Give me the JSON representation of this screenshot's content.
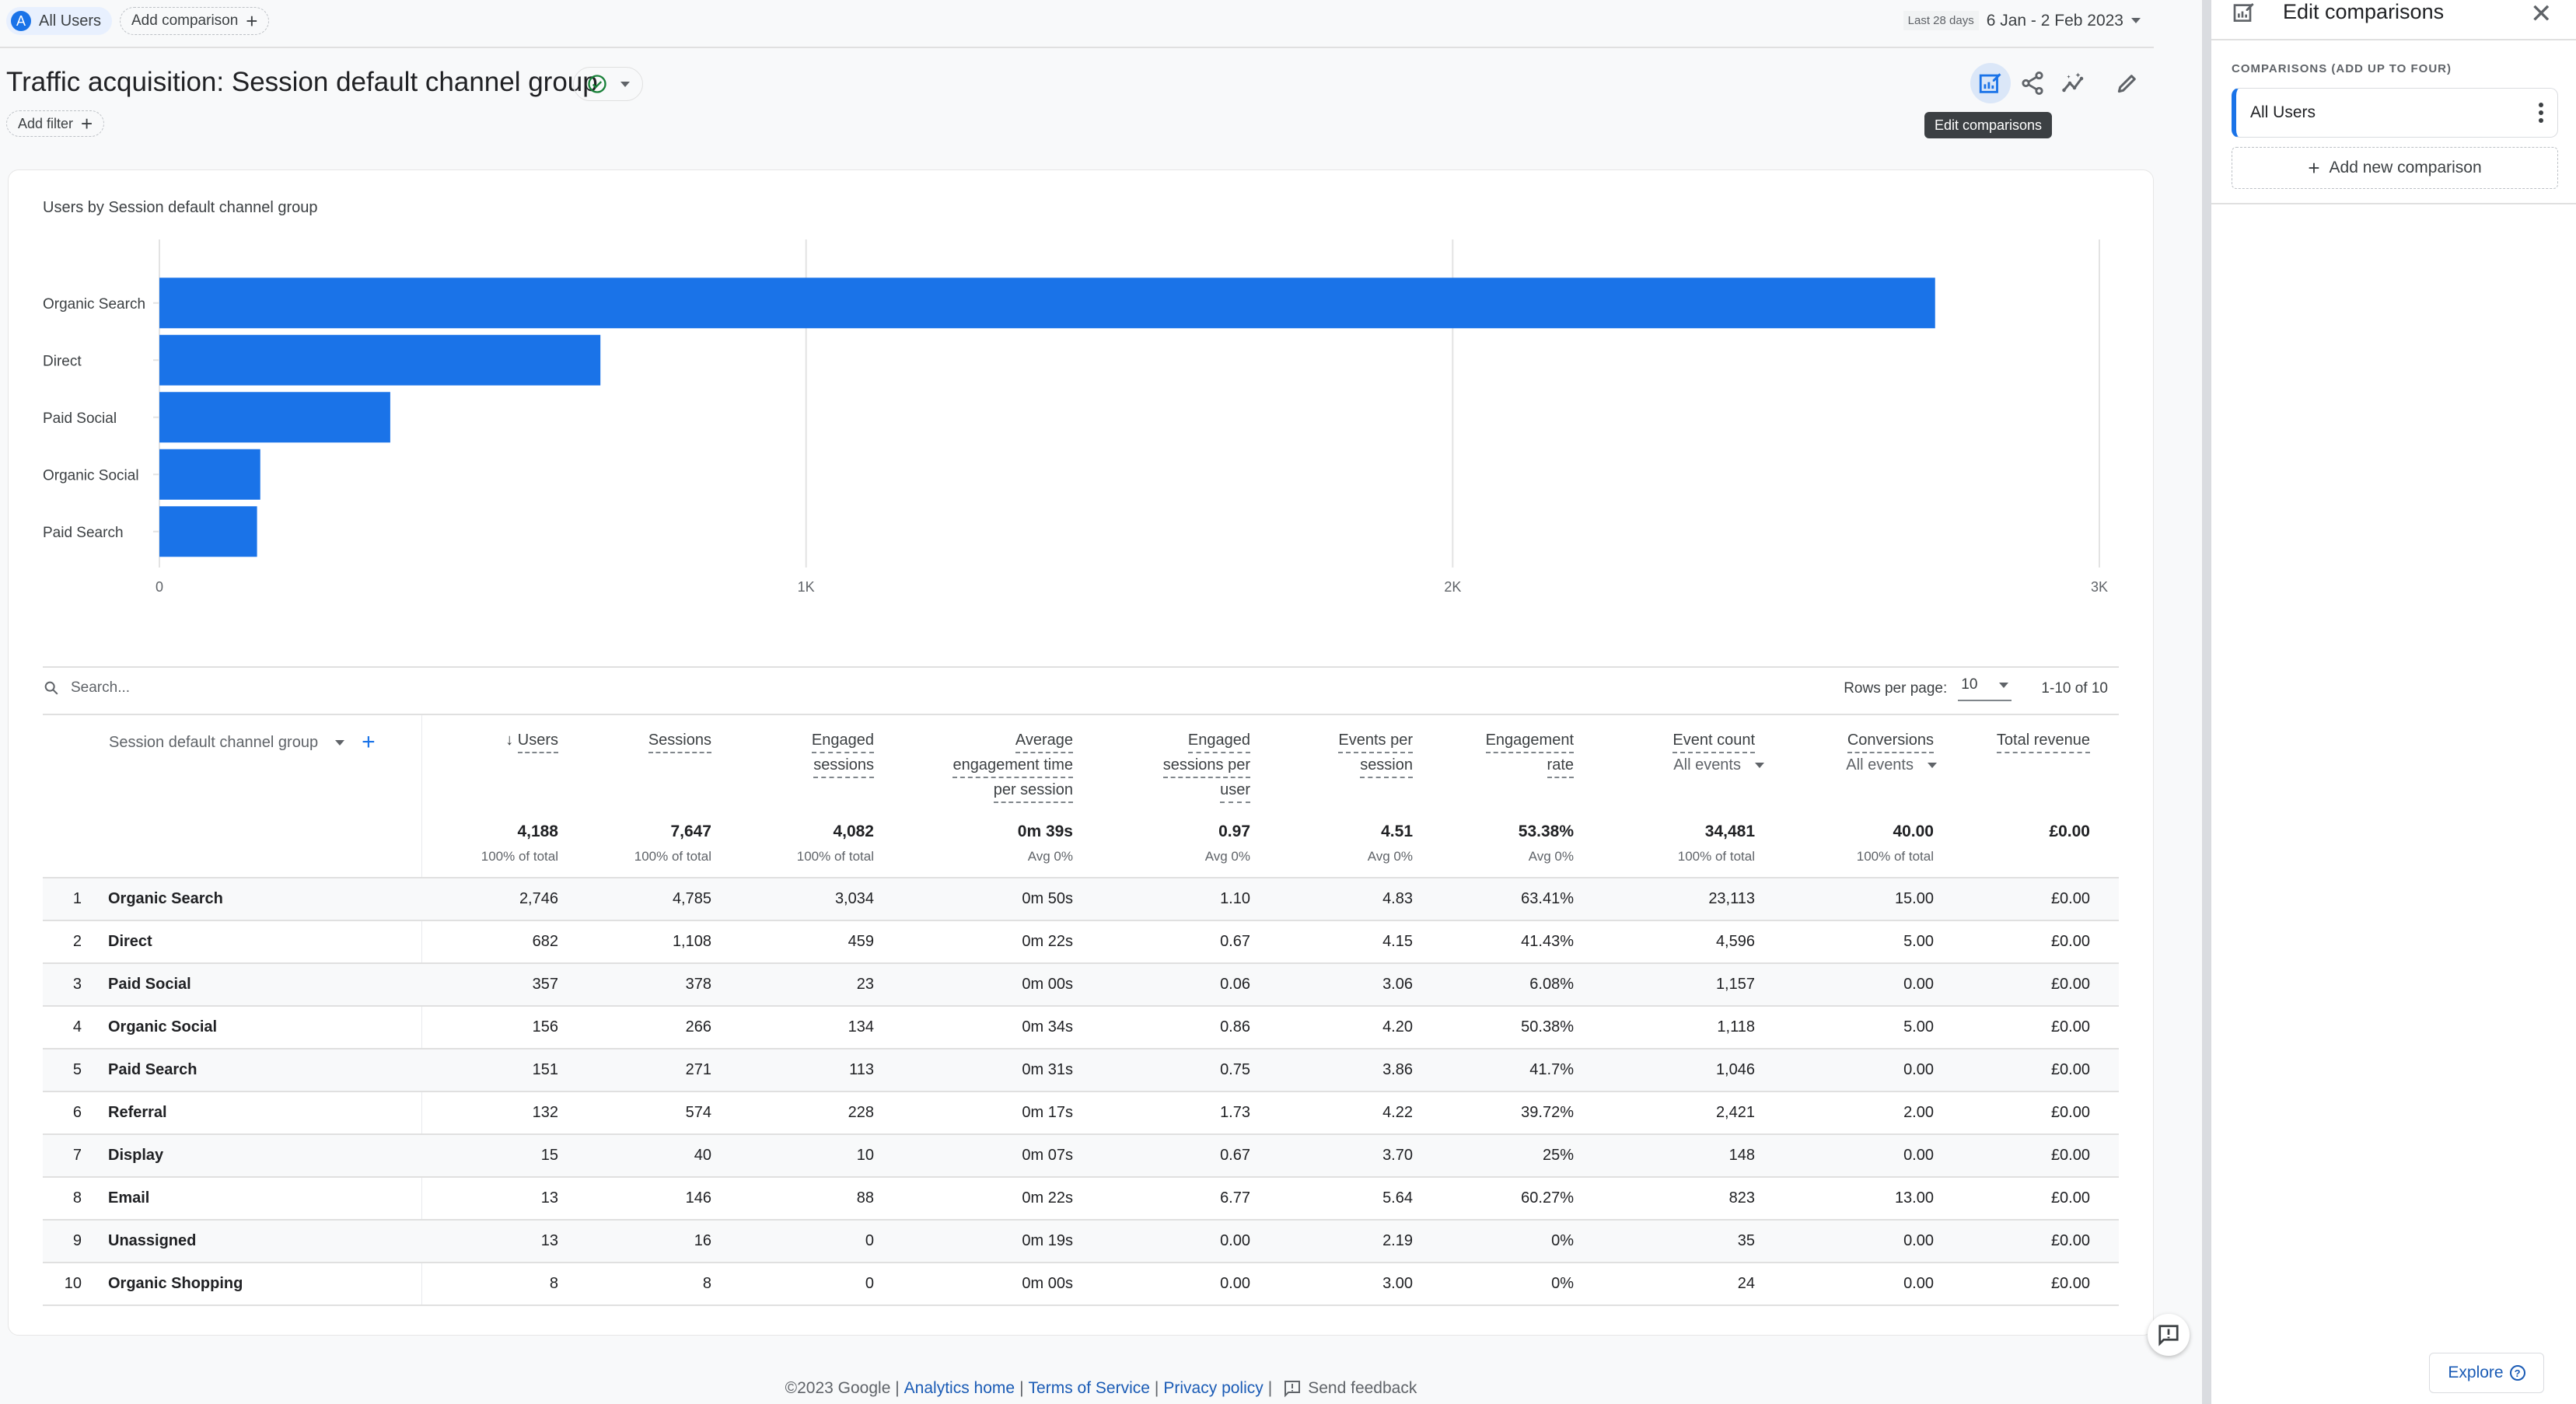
{
  "top_bar": {
    "segment_chip": {
      "avatar_letter": "A",
      "label": "All Users"
    },
    "add_comparison_label": "Add comparison",
    "date_range": {
      "preset": "Last 28 days",
      "value": "6 Jan - 2 Feb 2023"
    }
  },
  "header": {
    "title": "Traffic acquisition: Session default channel group",
    "add_filter_label": "Add filter",
    "toolbar": {
      "icons": [
        "edit-comparisons-icon",
        "share-icon",
        "insights-icon",
        "edit-pencil-icon"
      ],
      "tooltip": "Edit comparisons"
    }
  },
  "chart_data": {
    "type": "bar",
    "orientation": "horizontal",
    "title": "Users by Session default channel group",
    "categories": [
      "Organic Search",
      "Direct",
      "Paid Social",
      "Organic Social",
      "Paid Search"
    ],
    "values": [
      2746,
      682,
      357,
      156,
      151
    ],
    "xlabel": "",
    "ylabel": "",
    "xlim": [
      0,
      3000
    ],
    "xticks": [
      "0",
      "1K",
      "2K",
      "3K"
    ],
    "grid": true,
    "color": "#1a73e8"
  },
  "table": {
    "search_placeholder": "Search...",
    "rows_per_page_label": "Rows per page:",
    "rows_per_page_value": "10",
    "pagination": "1-10 of 10",
    "dimension_header": "Session default channel group",
    "columns": [
      {
        "label": [
          "Users"
        ],
        "sorted": true,
        "total": "4,188",
        "total_sub": "100% of total"
      },
      {
        "label": [
          "Sessions"
        ],
        "total": "7,647",
        "total_sub": "100% of total"
      },
      {
        "label": [
          "Engaged",
          "sessions"
        ],
        "total": "4,082",
        "total_sub": "100% of total"
      },
      {
        "label": [
          "Average",
          "engagement time",
          "per session"
        ],
        "total": "0m 39s",
        "total_sub": "Avg 0%"
      },
      {
        "label": [
          "Engaged",
          "sessions per",
          "user"
        ],
        "total": "0.97",
        "total_sub": "Avg 0%"
      },
      {
        "label": [
          "Events per",
          "session"
        ],
        "total": "4.51",
        "total_sub": "Avg 0%"
      },
      {
        "label": [
          "Engagement",
          "rate"
        ],
        "total": "53.38%",
        "total_sub": "Avg 0%"
      },
      {
        "label": [
          "Event count"
        ],
        "filter": "All events",
        "total": "34,481",
        "total_sub": "100% of total"
      },
      {
        "label": [
          "Conversions"
        ],
        "filter": "All events",
        "total": "40.00",
        "total_sub": "100% of total"
      },
      {
        "label": [
          "Total revenue"
        ],
        "total": "£0.00",
        "total_sub": ""
      }
    ],
    "rows": [
      {
        "idx": "1",
        "name": "Organic Search",
        "values": [
          "2,746",
          "4,785",
          "3,034",
          "0m 50s",
          "1.10",
          "4.83",
          "63.41%",
          "23,113",
          "15.00",
          "£0.00"
        ]
      },
      {
        "idx": "2",
        "name": "Direct",
        "values": [
          "682",
          "1,108",
          "459",
          "0m 22s",
          "0.67",
          "4.15",
          "41.43%",
          "4,596",
          "5.00",
          "£0.00"
        ]
      },
      {
        "idx": "3",
        "name": "Paid Social",
        "values": [
          "357",
          "378",
          "23",
          "0m 00s",
          "0.06",
          "3.06",
          "6.08%",
          "1,157",
          "0.00",
          "£0.00"
        ]
      },
      {
        "idx": "4",
        "name": "Organic Social",
        "values": [
          "156",
          "266",
          "134",
          "0m 34s",
          "0.86",
          "4.20",
          "50.38%",
          "1,118",
          "5.00",
          "£0.00"
        ]
      },
      {
        "idx": "5",
        "name": "Paid Search",
        "values": [
          "151",
          "271",
          "113",
          "0m 31s",
          "0.75",
          "3.86",
          "41.7%",
          "1,046",
          "0.00",
          "£0.00"
        ]
      },
      {
        "idx": "6",
        "name": "Referral",
        "values": [
          "132",
          "574",
          "228",
          "0m 17s",
          "1.73",
          "4.22",
          "39.72%",
          "2,421",
          "2.00",
          "£0.00"
        ]
      },
      {
        "idx": "7",
        "name": "Display",
        "values": [
          "15",
          "40",
          "10",
          "0m 07s",
          "0.67",
          "3.70",
          "25%",
          "148",
          "0.00",
          "£0.00"
        ]
      },
      {
        "idx": "8",
        "name": "Email",
        "values": [
          "13",
          "146",
          "88",
          "0m 22s",
          "6.77",
          "5.64",
          "60.27%",
          "823",
          "13.00",
          "£0.00"
        ]
      },
      {
        "idx": "9",
        "name": "Unassigned",
        "values": [
          "13",
          "16",
          "0",
          "0m 19s",
          "0.00",
          "2.19",
          "0%",
          "35",
          "0.00",
          "£0.00"
        ]
      },
      {
        "idx": "10",
        "name": "Organic Shopping",
        "values": [
          "8",
          "8",
          "0",
          "0m 00s",
          "0.00",
          "3.00",
          "0%",
          "24",
          "0.00",
          "£0.00"
        ]
      }
    ]
  },
  "footer": {
    "copyright": "©2023 Google |",
    "links": [
      "Analytics home",
      "Terms of Service",
      "Privacy policy"
    ],
    "feedback_label": "Send feedback"
  },
  "panel": {
    "title": "Edit comparisons",
    "section_label": "COMPARISONS (ADD UP TO FOUR)",
    "comparisons": [
      {
        "label": "All Users",
        "color": "#1a73e8"
      }
    ],
    "add_label": "Add new comparison",
    "explore_label": "Explore"
  }
}
